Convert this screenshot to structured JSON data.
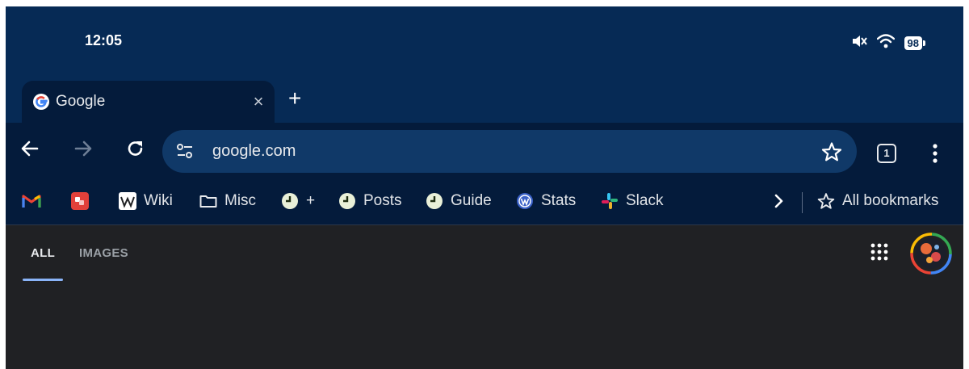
{
  "status_bar": {
    "time": "12:05",
    "icons": [
      "mute-icon",
      "wifi-icon",
      "battery-icon"
    ],
    "battery_level": "98"
  },
  "tab": {
    "title": "Google",
    "favicon": "google-favicon-icon",
    "close_label": "×",
    "new_tab_label": "+"
  },
  "toolbar": {
    "url": "google.com",
    "tab_count": "1",
    "icons": [
      "back-arrow-icon",
      "forward-arrow-icon",
      "reload-icon",
      "site-settings-icon",
      "star-icon",
      "more-vert-icon"
    ]
  },
  "bookmarks": {
    "items": [
      {
        "label": "",
        "icon": "gmail-icon"
      },
      {
        "label": "",
        "icon": "red-app-icon"
      },
      {
        "label": "Wiki",
        "icon": "wikipedia-icon"
      },
      {
        "label": "Misc",
        "icon": "folder-icon"
      },
      {
        "label": "+",
        "icon": "clock-icon"
      },
      {
        "label": "Posts",
        "icon": "clock-icon"
      },
      {
        "label": "Guide",
        "icon": "clock-icon"
      },
      {
        "label": "Stats",
        "icon": "wordpress-icon"
      },
      {
        "label": "Slack",
        "icon": "slack-icon"
      }
    ],
    "all_bookmarks_label": "All bookmarks"
  },
  "content": {
    "tabs": [
      "ALL",
      "IMAGES"
    ],
    "selected_tab": "ALL"
  },
  "colors": {
    "chrome_top": "#062a55",
    "toolbar": "#041b3b",
    "omnibox": "#103968",
    "content_bg": "#202124",
    "accent": "#8ab4f8"
  }
}
